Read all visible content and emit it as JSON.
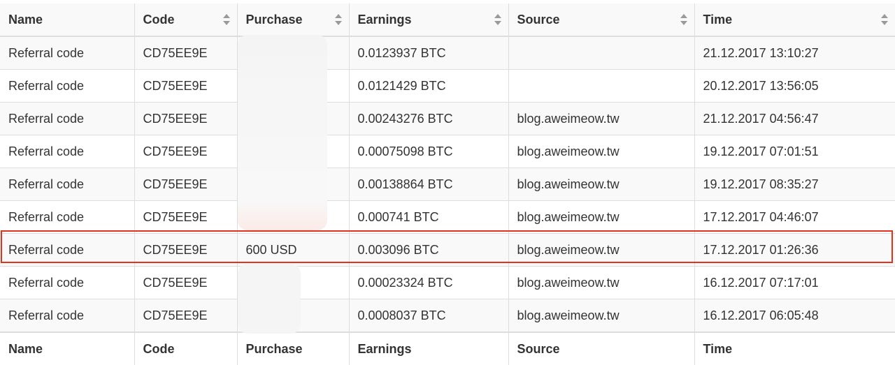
{
  "table": {
    "headers": [
      "Name",
      "Code",
      "Purchase",
      "Earnings",
      "Source",
      "Time"
    ],
    "rows": [
      [
        "Referral code",
        "CD75EE9E",
        "",
        "0.0123937 BTC",
        "",
        "21.12.2017 13:10:27"
      ],
      [
        "Referral code",
        "CD75EE9E",
        "",
        "0.0121429 BTC",
        "",
        "20.12.2017 13:56:05"
      ],
      [
        "Referral code",
        "CD75EE9E",
        "",
        "0.00243276 BTC",
        "blog.aweimeow.tw",
        "21.12.2017 04:56:47"
      ],
      [
        "Referral code",
        "CD75EE9E",
        "",
        "0.00075098 BTC",
        "blog.aweimeow.tw",
        "19.12.2017 07:01:51"
      ],
      [
        "Referral code",
        "CD75EE9E",
        "",
        "0.00138864 BTC",
        "blog.aweimeow.tw",
        "19.12.2017 08:35:27"
      ],
      [
        "Referral code",
        "CD75EE9E",
        "",
        "0.000741 BTC",
        "blog.aweimeow.tw",
        "17.12.2017 04:46:07"
      ],
      [
        "Referral code",
        "CD75EE9E",
        "600 USD",
        "0.003096 BTC",
        "blog.aweimeow.tw",
        "17.12.2017 01:26:36"
      ],
      [
        "Referral code",
        "CD75EE9E",
        "",
        "0.00023324 BTC",
        "blog.aweimeow.tw",
        "16.12.2017 07:17:01"
      ],
      [
        "Referral code",
        "CD75EE9E",
        "",
        "0.0008037 BTC",
        "blog.aweimeow.tw",
        "16.12.2017 06:05:48"
      ]
    ],
    "footers": [
      "Name",
      "Code",
      "Purchase",
      "Earnings",
      "Source",
      "Time"
    ],
    "sortable_columns": [
      false,
      true,
      true,
      true,
      true,
      true
    ],
    "highlighted_row": 6
  },
  "colors": {
    "highlight_border": "#e0331e",
    "stripe": "#f9f9f9",
    "text": "#333333",
    "border": "#dddddd"
  },
  "icons": {
    "sort": "sort-icon"
  }
}
